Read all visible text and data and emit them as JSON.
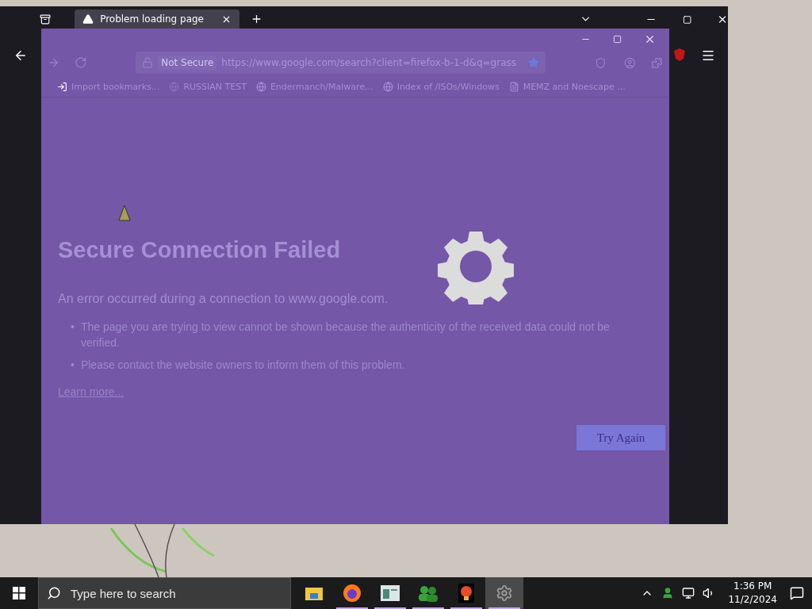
{
  "browser": {
    "tab": {
      "title": "Problem loading page"
    },
    "toolbar": {
      "security": "Not Secure",
      "url": "https://www.google.com/search?client=firefox-b-1-d&q=grass"
    },
    "bookmarks": [
      {
        "kind": "import",
        "label": "Import bookmarks..."
      },
      {
        "kind": "page",
        "label": "RUSSIAN TEST"
      },
      {
        "kind": "site",
        "label": "Endermanch/Malware..."
      },
      {
        "kind": "site",
        "label": "Index of /ISOs/Windows"
      },
      {
        "kind": "folder",
        "label": "MEMZ and Noescape ..."
      }
    ],
    "error": {
      "marker": "•",
      "title": "Secure Connection Failed",
      "message": "An error occurred during a connection to www.google.com.",
      "bullets": [
        "The page you are trying to view cannot be shown because the authenticity of the received data could not be verified.",
        "Please contact the website owners to inform them of this problem."
      ],
      "link": "Learn more...",
      "button": "Try Again"
    }
  },
  "taskbar": {
    "search": {
      "placeholder": "Type here to search"
    },
    "apps": [
      {
        "kind": "folder",
        "running": false,
        "selected": false
      },
      {
        "kind": "firefox",
        "running": true,
        "selected": false
      },
      {
        "kind": "window",
        "running": true,
        "selected": false
      },
      {
        "kind": "people",
        "running": true,
        "selected": false
      },
      {
        "kind": "red",
        "running": true,
        "selected": false
      },
      {
        "kind": "gear",
        "running": true,
        "selected": true
      }
    ],
    "time": "1:36 PM",
    "date": "11/2/2024"
  }
}
